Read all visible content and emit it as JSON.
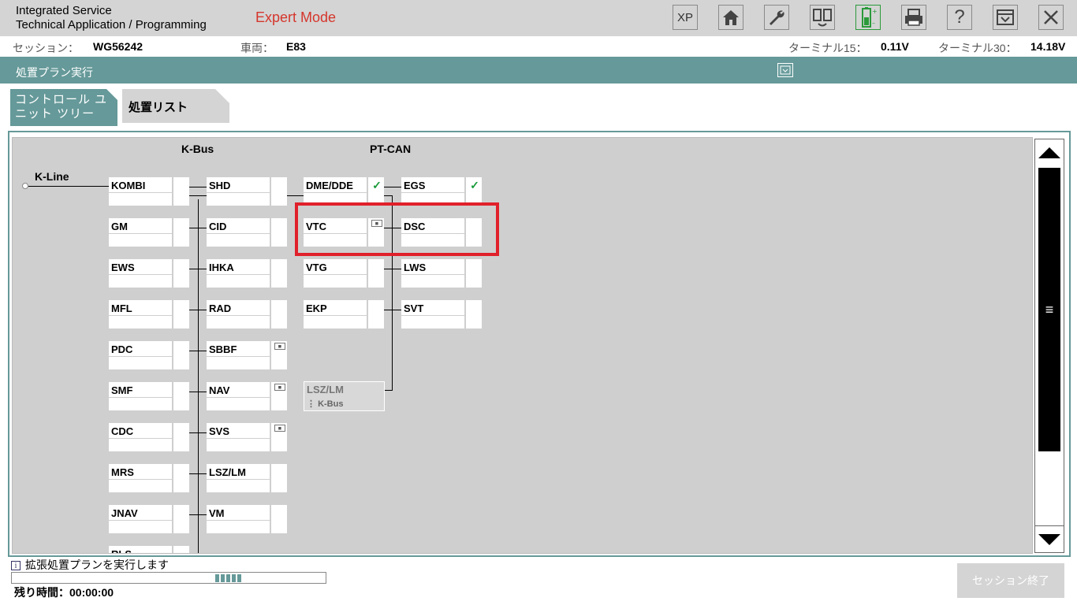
{
  "header": {
    "app_title_line1": "Integrated Service",
    "app_title_line2": "Technical Application / Programming",
    "mode": "Expert Mode",
    "xp_label": "XP"
  },
  "session_bar": {
    "session_label": "セッション：",
    "session_value": "WG56242",
    "vehicle_label": "車両：",
    "vehicle_value": "E83",
    "terminal15_label": "ターミナル15：",
    "terminal15_value": "0.11V",
    "terminal30_label": "ターミナル30：",
    "terminal30_value": "14.18V"
  },
  "plan_title": "処置プラン実行",
  "tabs": {
    "control_unit_tree": "コントロール ユニット ツリー",
    "treatment_list": "処置リスト"
  },
  "tree": {
    "bus_kbus": "K-Bus",
    "bus_ptcan": "PT-CAN",
    "kline_label": "K-Line",
    "col1": [
      "KOMBI",
      "GM",
      "EWS",
      "MFL",
      "PDC",
      "SMF",
      "CDC",
      "MRS",
      "JNAV",
      "RLS"
    ],
    "col2": [
      "SHD",
      "CID",
      "IHKA",
      "RAD",
      "SBBF",
      "NAV",
      "SVS",
      "LSZ/LM",
      "VM"
    ],
    "col3": [
      "DME/DDE",
      "VTC",
      "VTG",
      "EKP"
    ],
    "col4": [
      "EGS",
      "DSC",
      "LWS",
      "SVT"
    ],
    "lsz_gray": "LSZ/LM",
    "lsz_gray_sub": "K-Bus",
    "check_mark": "✓"
  },
  "status": {
    "message": "拡張処置プランを実行します",
    "info_icon": "i",
    "remaining": "残り時間：00:00:00",
    "progress_segments": 5
  },
  "end_session_button": "セッション終了"
}
